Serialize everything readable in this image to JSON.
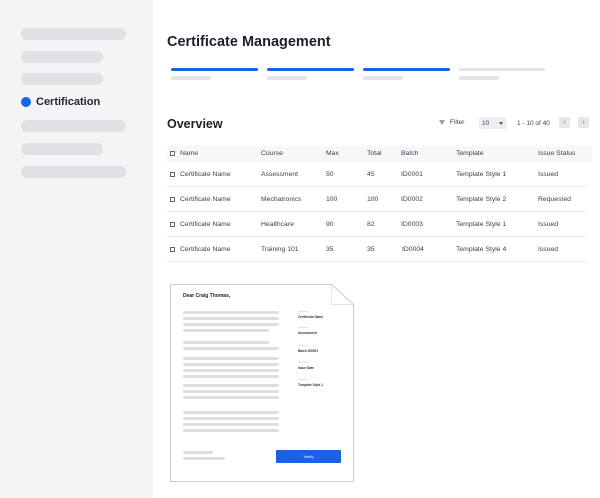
{
  "sidebar": {
    "active_label": "Certification",
    "accent": "#1663e6"
  },
  "header": {
    "title": "Certificate Management"
  },
  "overview": {
    "title": "Overview",
    "filter_label": "Filter",
    "per_page": "10",
    "range_text": "1 - 10 of 40",
    "prev_icon": "chevron-left-icon",
    "next_icon": "chevron-right-icon"
  },
  "table": {
    "columns": [
      "Name",
      "Course",
      "Max",
      "Total",
      "Batch",
      "Template",
      "Issue Status"
    ],
    "rows": [
      [
        "Certificate Name",
        "Assessment",
        "50",
        "45",
        "ID0001",
        "Template Style 1",
        "Issued"
      ],
      [
        "Certificate Name",
        "Mechatronics",
        "100",
        "100",
        "ID0002",
        "Template Style 2",
        "Requested"
      ],
      [
        "Certificate Name",
        "Healthcare",
        "90",
        "82",
        "ID0003",
        "Template Style 1",
        "Issued"
      ],
      [
        "Certificate Name",
        "Training 101",
        "35",
        "35",
        "ID0004",
        "Template Style 4",
        "Issued"
      ]
    ]
  },
  "certificate": {
    "greeting": "Dear Craig Thomas,",
    "meta": [
      "Certificate Name",
      "Assessment",
      "Batch ID0001",
      "Issue Date",
      "Template Style 1"
    ],
    "verify_label": "Verify"
  }
}
